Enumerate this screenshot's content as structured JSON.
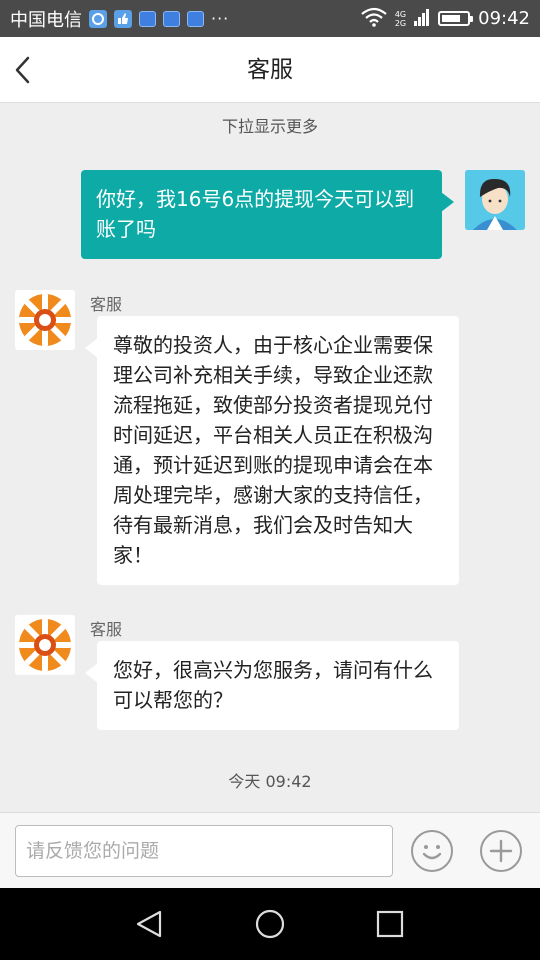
{
  "status_bar": {
    "carrier": "中国电信",
    "time": "09:42",
    "network_top": "4G",
    "network_bottom": "2G",
    "more_indicator": "···",
    "battery_level": 0.75
  },
  "header": {
    "title": "客服",
    "back_icon": "chevron-left-icon"
  },
  "chat": {
    "load_more": "下拉显示更多",
    "messages": [
      {
        "direction": "outgoing",
        "text": "你好，我16号6点的提现今天可以到账了吗"
      },
      {
        "direction": "incoming",
        "sender": "客服",
        "text": "尊敬的投资人，由于核心企业需要保理公司补充相关手续，导致企业还款流程拖延，致使部分投资者提现兑付时间延迟，平台相关人员正在积极沟通，预计延迟到账的提现申请会在本周处理完毕，感谢大家的支持信任，待有最新消息，我们会及时告知大家！"
      },
      {
        "direction": "incoming",
        "sender": "客服",
        "text": "您好，很高兴为您服务，请问有什么可以帮您的？"
      }
    ],
    "timestamp": "今天 09:42"
  },
  "input_bar": {
    "placeholder": "请反馈您的问题",
    "emoji_icon": "smiley-icon",
    "plus_icon": "plus-icon"
  },
  "nav_bar": {
    "back_icon": "triangle-back-icon",
    "home_icon": "circle-home-icon",
    "recent_icon": "square-recent-icon"
  },
  "colors": {
    "accent": "#0eaaa6",
    "status_bar": "#4a4a4a",
    "chat_background": "#eeeeee"
  }
}
